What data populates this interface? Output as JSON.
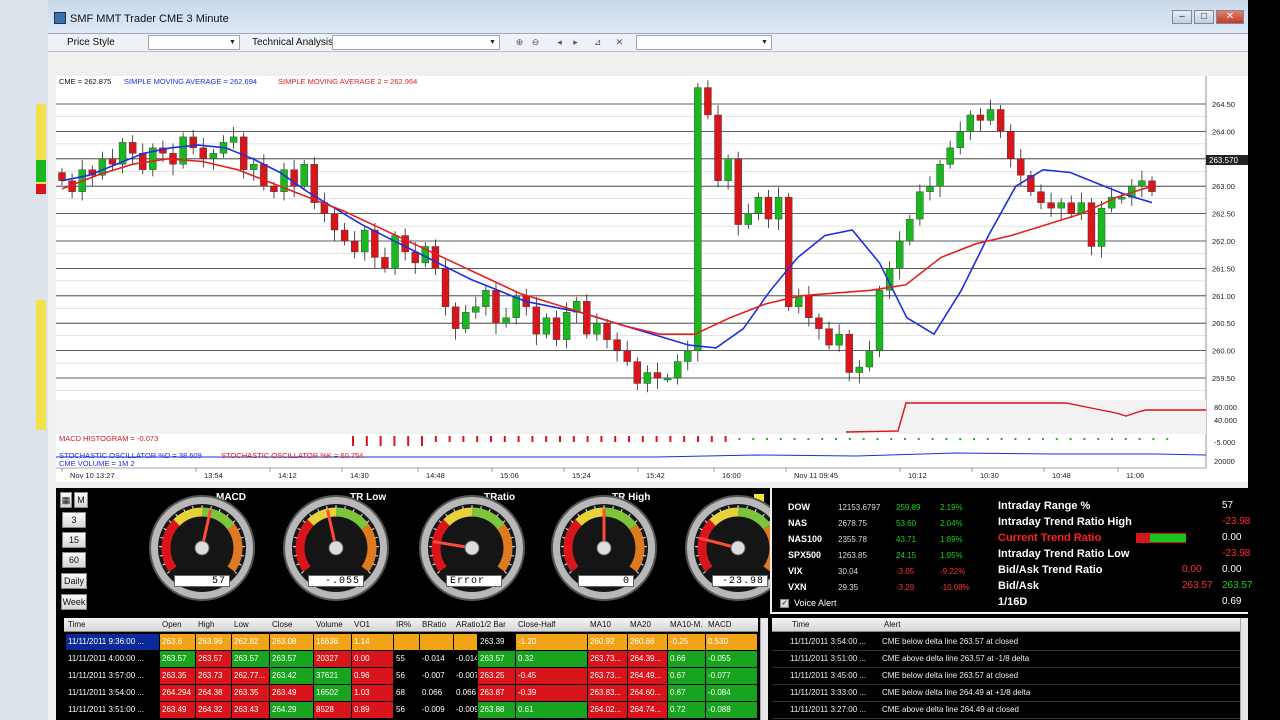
{
  "window": {
    "title": "SMF MMT Trader CME  3 Minute"
  },
  "toolbar": {
    "price_style_label": "Price Style",
    "technical_analysis_label": "Technical Analysis"
  },
  "chart": {
    "legend": {
      "cme": "CME = 262.875",
      "sma1": "SIMPLE MOVING AVERAGE = 262.694",
      "sma2": "SIMPLE MOVING AVERAGE 2 = 262.964"
    },
    "price_axis": [
      "264.50",
      "264.00",
      "263.50",
      "263.00",
      "262.50",
      "262.00",
      "261.50",
      "261.00",
      "260.50",
      "260.00",
      "259.50"
    ],
    "current_price": "263.570",
    "lower_axis": [
      "80.000",
      "40.000",
      "-5.000",
      "20000"
    ],
    "macd_label": "MACD HISTOGRAM = -0.073",
    "stoch_label1": "STOCHASTIC OSCILLATOR %D = 38.609",
    "stoch_label2": "STOCHASTIC OSCILLATOR %K = 60.754",
    "volume_label": "CME VOLUME = 1M 2",
    "time_axis": [
      "Nov 10 13:27",
      "13:54",
      "14:12",
      "14:30",
      "14:48",
      "15:06",
      "15:24",
      "15:42",
      "16:00",
      "Nov 11 09:45",
      "10:12",
      "10:30",
      "10:48",
      "11:06"
    ],
    "colors": {
      "up": "#19b81f",
      "down": "#d8151a",
      "sma1": "#1c2fe0",
      "sma2": "#e32020"
    }
  },
  "chart_data": {
    "type": "candlestick",
    "ylim": [
      259.2,
      264.85
    ],
    "legend_position": "top-left",
    "grid": true,
    "series": [
      {
        "name": "CME",
        "values": [
          263.1,
          262.9,
          263.3,
          263.2,
          263.5,
          263.4,
          263.8,
          263.6,
          263.3,
          263.7,
          263.6,
          263.4,
          263.9,
          263.7,
          263.5,
          263.6,
          263.8,
          263.9,
          263.3,
          263.4,
          263.0,
          262.9,
          263.3,
          263.0,
          263.4,
          262.7,
          262.5,
          262.2,
          262.0,
          261.8,
          262.2,
          261.7,
          261.5,
          262.1,
          261.8,
          261.6,
          261.9,
          261.5,
          260.8,
          260.4,
          260.7,
          260.8,
          261.1,
          260.5,
          260.6,
          261.0,
          260.8,
          260.3,
          260.6,
          260.2,
          260.7,
          260.9,
          260.3,
          260.5,
          260.2,
          260.0,
          259.8,
          259.4,
          259.6,
          259.5,
          259.5,
          259.8,
          260.0,
          264.8,
          264.3,
          263.1,
          263.5,
          262.3,
          262.5,
          262.8,
          262.4,
          262.8,
          260.8,
          261.0,
          260.6,
          260.4,
          260.1,
          260.3,
          259.6,
          259.7,
          260.0,
          261.1,
          261.5,
          262.0,
          262.4,
          262.9,
          263.0,
          263.4,
          263.7,
          264.0,
          264.3,
          264.2,
          264.4,
          264.0,
          263.5,
          263.2,
          262.9,
          262.7,
          262.6,
          262.7,
          262.5,
          262.7,
          261.9,
          262.6,
          262.8,
          262.8,
          263.0,
          263.1,
          262.9
        ]
      },
      {
        "name": "SIMPLE MOVING AVERAGE",
        "values": [
          263.1,
          263.2,
          263.4,
          263.6,
          263.7,
          263.75,
          263.7,
          263.5,
          263.25,
          262.9,
          262.6,
          262.3,
          262.05,
          261.8,
          261.55,
          261.3,
          261.1,
          260.9,
          260.8,
          260.7,
          260.55,
          260.4,
          260.25,
          260.1,
          260.05,
          260.4,
          261.1,
          261.7,
          262.1,
          262.2,
          261.6,
          260.6,
          260.3,
          261.1,
          262.1,
          263.0,
          263.3,
          263.25,
          263.05,
          262.85,
          262.7
        ]
      },
      {
        "name": "SIMPLE MOVING AVERAGE 2",
        "values": [
          262.95,
          263.2,
          263.4,
          263.5,
          263.45,
          263.3,
          263.05,
          262.8,
          262.55,
          262.25,
          261.95,
          261.65,
          261.35,
          261.05,
          260.85,
          260.65,
          260.45,
          260.3,
          260.3,
          260.6,
          260.85,
          261.0,
          261.05,
          261.1,
          261.2,
          261.7,
          261.95,
          262.1,
          262.3,
          262.5,
          262.8,
          263.0
        ]
      }
    ]
  },
  "gauges": {
    "side_buttons": [
      "M",
      "3",
      "15",
      "60",
      "Daily",
      "Week"
    ],
    "items": [
      {
        "title": "MACD",
        "value": "57",
        "needle": 0.55
      },
      {
        "title": "TR Low",
        "value": "-.055",
        "needle": 0.45
      },
      {
        "title": "TRatio",
        "value": "Error",
        "needle": 0.18
      },
      {
        "title": "TR High",
        "value": "0",
        "needle": 0.5
      },
      {
        "title": "",
        "value": "-23.98",
        "needle": 0.2
      }
    ]
  },
  "market": {
    "rows": [
      {
        "sym": "DOW",
        "price": "12153.6797",
        "chg": "259.89",
        "pct": "2.19%",
        "pos": true
      },
      {
        "sym": "NAS",
        "price": "2678.75",
        "chg": "53.60",
        "pct": "2.04%",
        "pos": true
      },
      {
        "sym": "NAS100",
        "price": "2355.78",
        "chg": "43.71",
        "pct": "1.89%",
        "pos": true
      },
      {
        "sym": "SPX500",
        "price": "1263.85",
        "chg": "24.15",
        "pct": "1.95%",
        "pos": true
      },
      {
        "sym": "VIX",
        "price": "30.04",
        "chg": "-3.05",
        "pct": "-9.22%",
        "pos": false
      },
      {
        "sym": "VXN",
        "price": "29.35",
        "chg": "-3.29",
        "pct": "-10.08%",
        "pos": false
      }
    ],
    "voice_alert_label": "Voice Alert",
    "stats": [
      {
        "label": "Intraday Range %",
        "val1": "",
        "val2": "57",
        "label_color": "#ffffff",
        "v2_color": "#ffffff"
      },
      {
        "label": "Intraday Trend Ratio High",
        "val1": "",
        "val2": "-23.98",
        "label_color": "#ffffff",
        "v2_color": "#ff3030"
      },
      {
        "label": "Current Trend Ratio",
        "val1": "",
        "val2": "0.00",
        "label_color": "#ff2020",
        "v2_color": "#ffffff"
      },
      {
        "label": "Intraday Trend Ratio Low",
        "val1": "",
        "val2": "-23.98",
        "label_color": "#ffffff",
        "v2_color": "#ff3030"
      },
      {
        "label": "Bid/Ask Trend Ratio",
        "val1": "0.00",
        "val2": "0.00",
        "label_color": "#ffffff",
        "v2_color": "#ffffff"
      },
      {
        "label": "Bid/Ask",
        "val1": "263.57",
        "val2": "263.57",
        "label_color": "#ffffff",
        "v2_color": "#19d01f"
      },
      {
        "label": "1/16D",
        "val1": "",
        "val2": "0.69",
        "label_color": "#ffffff",
        "v2_color": "#ffffff"
      }
    ]
  },
  "grid": {
    "headers": [
      "Time",
      "Open",
      "High",
      "Low",
      "Close",
      "Volume",
      "VO1",
      "IR%",
      "BRatio",
      "ARatio",
      "1/2 Bar",
      "Close-Half",
      "MA10",
      "MA20",
      "MA10-M.",
      "MACD"
    ],
    "rows": [
      [
        "11/11/2011 9:36:00 ...",
        "263.6",
        "263.96",
        "262.82",
        "263.08",
        "16636",
        "1.14",
        "",
        "",
        "",
        "263.39",
        "-1.20",
        "260.92",
        "260.66",
        "-0.25",
        "0.530"
      ],
      [
        "11/11/2011 4:00:00 ...",
        "263.57",
        "263.57",
        "263.57",
        "263.57",
        "20327",
        "0.00",
        "55",
        "-0.014",
        "-0.014",
        "263.57",
        "0.32",
        "263.73...",
        "264.39...",
        "0.66",
        "-0.055"
      ],
      [
        "11/11/2011 3:57:00 ...",
        "263.35",
        "263.73",
        "262.77...",
        "263.42",
        "37621",
        "0.96",
        "56",
        "-0.007",
        "-0.007",
        "263.25",
        "-0.45",
        "263.73...",
        "264.49...",
        "0.67",
        "-0.077"
      ],
      [
        "11/11/2011 3:54:00 ...",
        "264.294",
        "264.38",
        "263.35",
        "263.49",
        "16502",
        "1.03",
        "68",
        "0.066",
        "0.066",
        "263.87",
        "-0.39",
        "263.83...",
        "264.60...",
        "0.67",
        "-0.084"
      ],
      [
        "11/11/2011 3:51:00 ...",
        "263.49",
        "264.32",
        "263.43",
        "264.29",
        "8528",
        "0.89",
        "56",
        "-0.009",
        "-0.009",
        "263.88",
        "0.61",
        "264.02...",
        "264.74...",
        "0.72",
        "-0.088"
      ]
    ]
  },
  "alerts": {
    "headers": [
      "Time",
      "Alert"
    ],
    "rows": [
      [
        "11/11/2011 3:54:00 ...",
        "CME below delta line 263.57 at closed"
      ],
      [
        "11/11/2011 3:51:00 ...",
        "CME above delta line 263.57 at -1/8 delta"
      ],
      [
        "11/11/2011 3:45:00 ...",
        "CME below delta line 263.57 at closed"
      ],
      [
        "11/11/2011 3:33:00 ...",
        "CME below delta line 264.49 at +1/8 delta"
      ],
      [
        "11/11/2011 3:27:00 ...",
        "CME above delta line 264.49 at closed"
      ]
    ]
  }
}
